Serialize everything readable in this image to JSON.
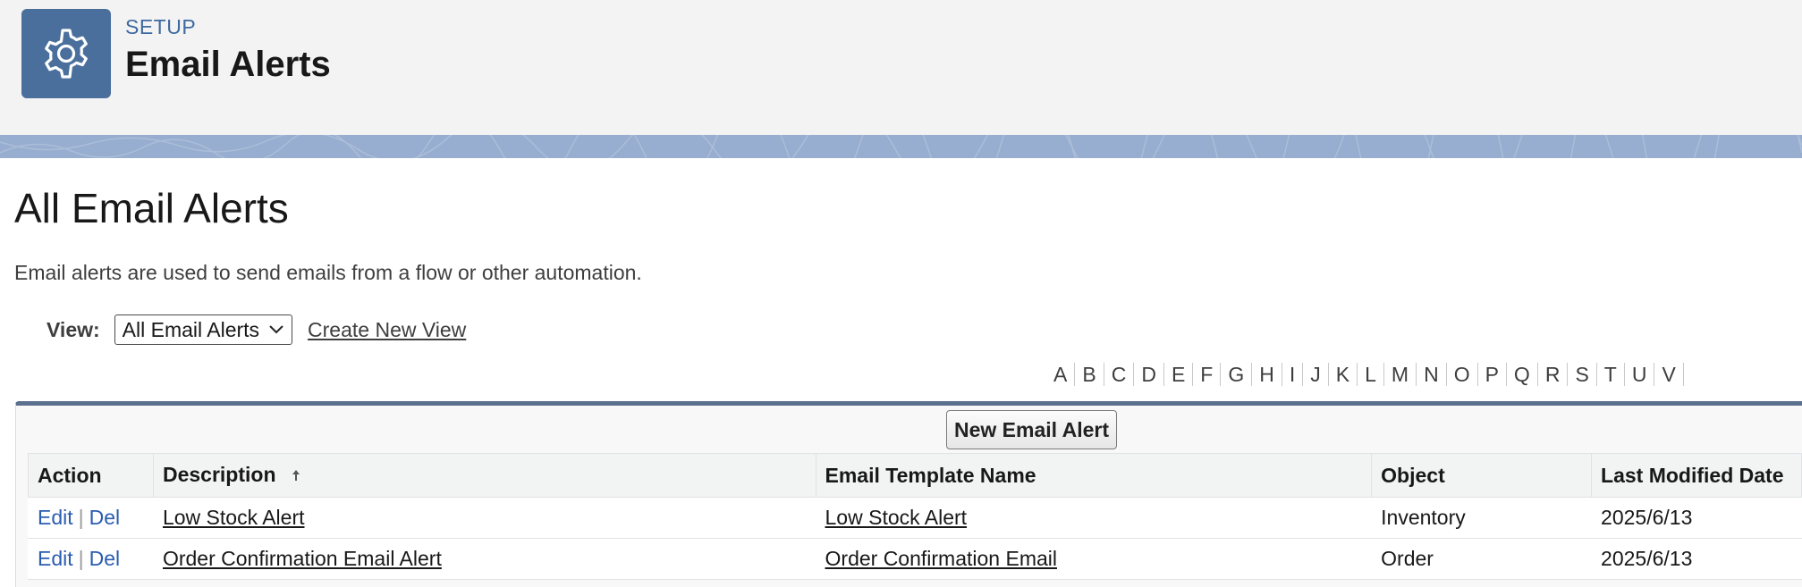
{
  "header": {
    "icon": "gear-icon",
    "subtitle": "SETUP",
    "title": "Email Alerts"
  },
  "content": {
    "title": "All Email Alerts",
    "description": "Email alerts are used to send emails from a flow or other automation.",
    "view_label": "View:",
    "view_selected": "All Email Alerts",
    "create_view_link": "Create New View"
  },
  "alphabet": [
    "A",
    "B",
    "C",
    "D",
    "E",
    "F",
    "G",
    "H",
    "I",
    "J",
    "K",
    "L",
    "M",
    "N",
    "O",
    "P",
    "Q",
    "R",
    "S",
    "T",
    "U",
    "V"
  ],
  "toolbar": {
    "new_button": "New Email Alert"
  },
  "table": {
    "columns": [
      "Action",
      "Description",
      "Email Template Name",
      "Object",
      "Last Modified Date"
    ],
    "rows": [
      {
        "edit": "Edit",
        "sep": "|",
        "del": "Del",
        "description": "Low Stock Alert",
        "template": "Low Stock Alert",
        "object": "Inventory",
        "modified": "2025/6/13"
      },
      {
        "edit": "Edit",
        "sep": "|",
        "del": "Del",
        "description": "Order Confirmation Email Alert",
        "template": "Order Confirmation Email",
        "object": "Order",
        "modified": "2025/6/13"
      }
    ]
  },
  "colors": {
    "header_bg": "#f3f3f3",
    "icon_bg": "#4a6f9c",
    "band": "#98aed0",
    "link_blue": "#2a5db0",
    "panel_border": "#5b6f8e"
  }
}
